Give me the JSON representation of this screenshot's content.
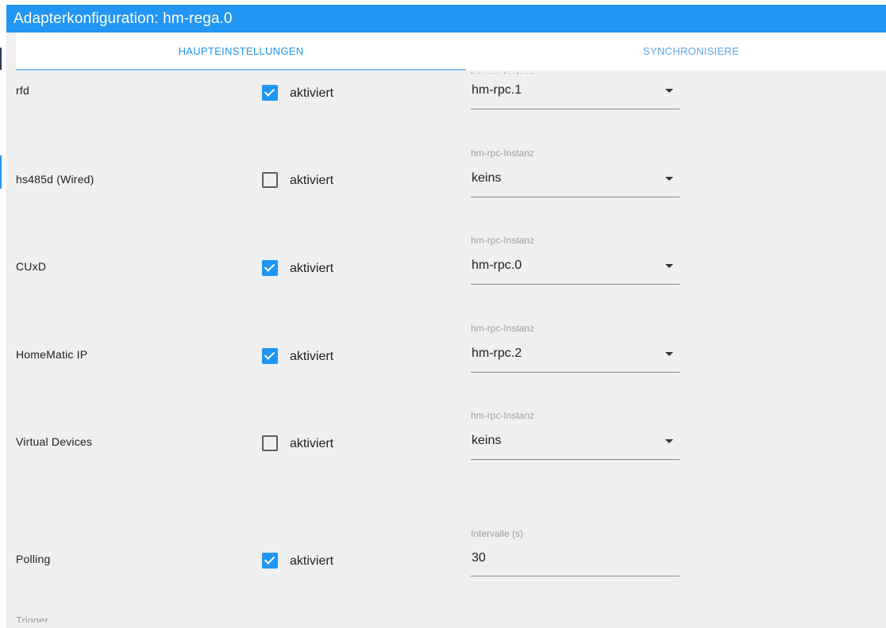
{
  "window": {
    "title": "Adapterkonfiguration: hm-rega.0"
  },
  "tabs": [
    {
      "label": "HAUPTEINSTELLUNGEN"
    },
    {
      "label": "SYNCHRONISIERE"
    }
  ],
  "checkbox_label": "aktiviert",
  "rows": [
    {
      "label": "rfd",
      "checked": true,
      "field_label": "hm-rpc-Instanz",
      "value": "hm-rpc.1"
    },
    {
      "label": "hs485d (Wired)",
      "checked": false,
      "field_label": "hm-rpc-Instanz",
      "value": "keins"
    },
    {
      "label": "CUxD",
      "checked": true,
      "field_label": "hm-rpc-Instanz",
      "value": "hm-rpc.0"
    },
    {
      "label": "HomeMatic IP",
      "checked": true,
      "field_label": "hm-rpc-Instanz",
      "value": "hm-rpc.2"
    },
    {
      "label": "Virtual Devices",
      "checked": false,
      "field_label": "hm-rpc-Instanz",
      "value": "keins"
    }
  ],
  "polling": {
    "label": "Polling",
    "checked": true,
    "field_label": "Intervalle (s)",
    "value": "30"
  },
  "trigger": {
    "label": "Trigger"
  },
  "colors": {
    "accent": "#2196f3",
    "background": "#efefef"
  },
  "icons": {
    "checkbox_checked": "check-icon",
    "dropdown": "caret-down-icon"
  }
}
